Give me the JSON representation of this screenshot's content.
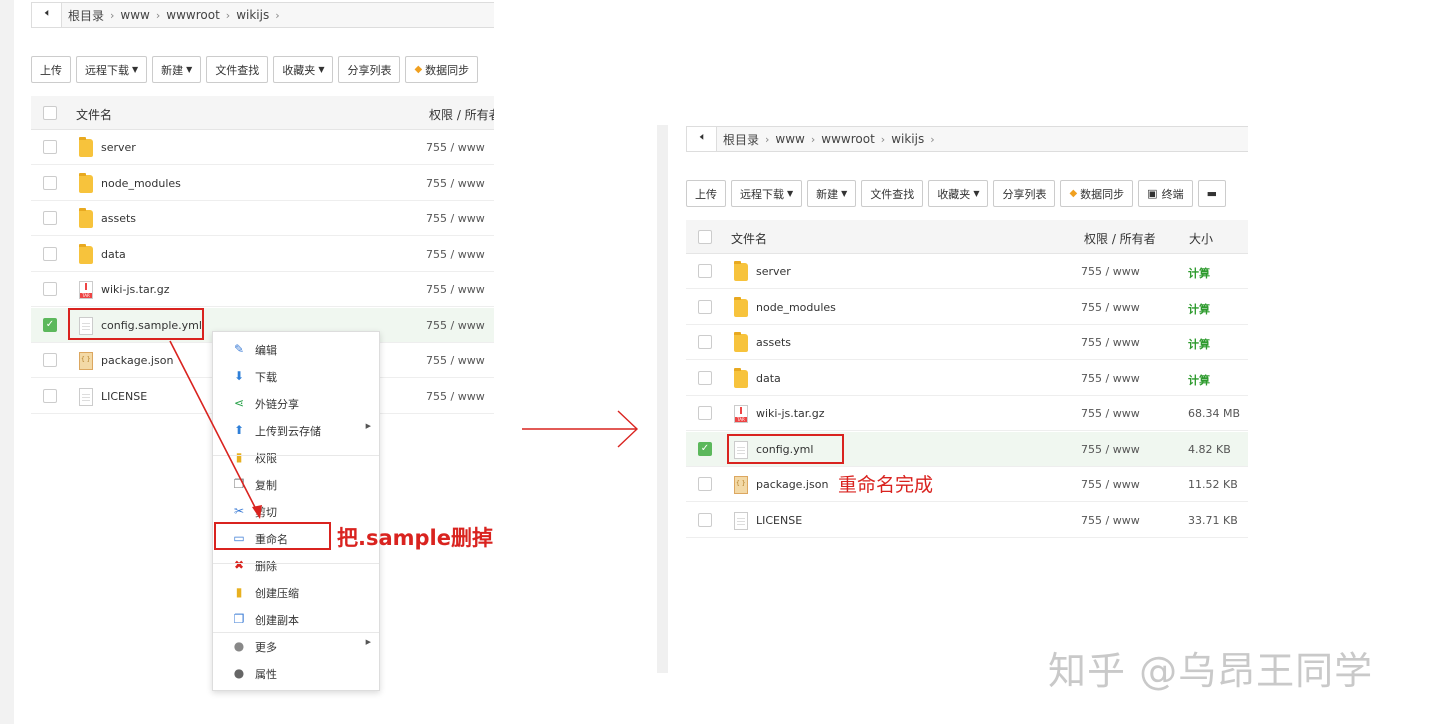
{
  "left_panel": {
    "breadcrumb": [
      "根目录",
      "www",
      "wwwroot",
      "wikijs"
    ],
    "toolbar": [
      "上传",
      "远程下载",
      "新建",
      "文件查找",
      "收藏夹",
      "分享列表",
      "数据同步"
    ],
    "header": {
      "name": "文件名",
      "perm": "权限 / 所有者"
    },
    "rows": [
      {
        "name": "server",
        "perm": "755 / www",
        "type": "folder",
        "checked": false
      },
      {
        "name": "node_modules",
        "perm": "755 / www",
        "type": "folder",
        "checked": false
      },
      {
        "name": "assets",
        "perm": "755 / www",
        "type": "folder",
        "checked": false
      },
      {
        "name": "data",
        "perm": "755 / www",
        "type": "folder",
        "checked": false
      },
      {
        "name": "wiki-js.tar.gz",
        "perm": "755 / www",
        "type": "tar",
        "checked": false
      },
      {
        "name": "config.sample.yml",
        "perm": "755 / www",
        "type": "doc",
        "checked": true
      },
      {
        "name": "package.json",
        "perm": "755 / www",
        "type": "json",
        "checked": false
      },
      {
        "name": "LICENSE",
        "perm": "755 / www",
        "type": "doc",
        "checked": false
      }
    ]
  },
  "context_menu": {
    "items": [
      {
        "label": "编辑",
        "icon": "edit-icon",
        "glyph": "✎",
        "color": "#3a7bd5",
        "arrow": false
      },
      {
        "label": "下载",
        "icon": "download-icon",
        "glyph": "⬇",
        "color": "#2f7fd8",
        "arrow": false
      },
      {
        "label": "外链分享",
        "icon": "share-icon",
        "glyph": "⋖",
        "color": "#2da44e",
        "arrow": false
      },
      {
        "label": "上传到云存储",
        "icon": "cloud-upload-icon",
        "glyph": "⬆",
        "color": "#2f7fd8",
        "arrow": true
      },
      {
        "label": "权限",
        "icon": "lock-folder-icon",
        "glyph": "▮",
        "color": "#e8b020",
        "arrow": false
      },
      {
        "label": "复制",
        "icon": "copy-icon",
        "glyph": "❐",
        "color": "#777777",
        "arrow": false
      },
      {
        "label": "剪切",
        "icon": "cut-icon",
        "glyph": "✂",
        "color": "#3a7bd5",
        "arrow": false
      },
      {
        "label": "重命名",
        "icon": "rename-icon",
        "glyph": "▭",
        "color": "#3a7bd5",
        "arrow": false
      },
      {
        "label": "删除",
        "icon": "delete-icon",
        "glyph": "✖",
        "color": "#d9231f",
        "arrow": false
      },
      {
        "label": "创建压缩",
        "icon": "compress-icon",
        "glyph": "▮",
        "color": "#e8b020",
        "arrow": false
      },
      {
        "label": "创建副本",
        "icon": "duplicate-icon",
        "glyph": "❐",
        "color": "#3a7bd5",
        "arrow": false
      },
      {
        "label": "更多",
        "icon": "more-icon",
        "glyph": "●",
        "color": "#888888",
        "arrow": true
      },
      {
        "label": "属性",
        "icon": "info-icon",
        "glyph": "●",
        "color": "#666666",
        "arrow": false
      }
    ]
  },
  "annotation_left": "把.sample删掉",
  "right_panel": {
    "breadcrumb": [
      "根目录",
      "www",
      "wwwroot",
      "wikijs"
    ],
    "toolbar": [
      "上传",
      "远程下载",
      "新建",
      "文件查找",
      "收藏夹",
      "分享列表",
      "数据同步",
      "终端"
    ],
    "header": {
      "name": "文件名",
      "perm": "权限 / 所有者",
      "size": "大小"
    },
    "rows": [
      {
        "name": "server",
        "perm": "755 / www",
        "size": "计算",
        "type": "folder",
        "checked": false
      },
      {
        "name": "node_modules",
        "perm": "755 / www",
        "size": "计算",
        "type": "folder",
        "checked": false
      },
      {
        "name": "assets",
        "perm": "755 / www",
        "size": "计算",
        "type": "folder",
        "checked": false
      },
      {
        "name": "data",
        "perm": "755 / www",
        "size": "计算",
        "type": "folder",
        "checked": false
      },
      {
        "name": "wiki-js.tar.gz",
        "perm": "755 / www",
        "size": "68.34 MB",
        "type": "tar",
        "checked": false
      },
      {
        "name": "config.yml",
        "perm": "755 / www",
        "size": "4.82 KB",
        "type": "doc",
        "checked": true
      },
      {
        "name": "package.json",
        "perm": "755 / www",
        "size": "11.52 KB",
        "type": "json",
        "checked": false
      },
      {
        "name": "LICENSE",
        "perm": "755 / www",
        "size": "33.71 KB",
        "type": "doc",
        "checked": false
      }
    ]
  },
  "annotation_right": "重命名完成",
  "watermark": "知乎 @乌昂王同学",
  "colors": {
    "annotation_red": "#d9231f",
    "calc_green": "#2d9a2d",
    "check_green": "#5cb85c"
  }
}
